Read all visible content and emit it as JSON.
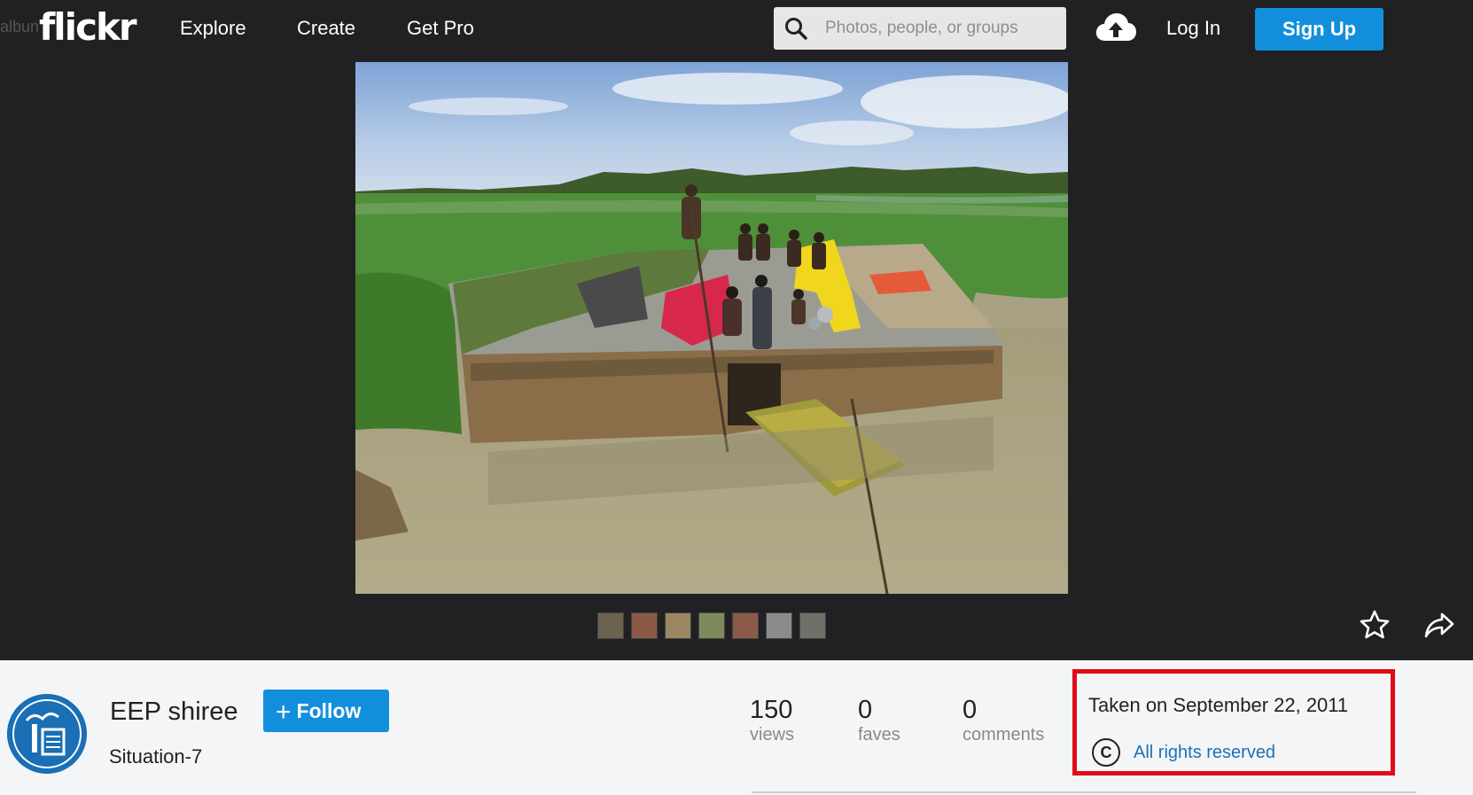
{
  "nav": {
    "ghost_text": "albun",
    "logo": "flickr",
    "links": [
      "Explore",
      "Create",
      "Get Pro"
    ],
    "search_placeholder": "Photos, people, or groups",
    "login": "Log In",
    "signup": "Sign Up"
  },
  "photo": {
    "thumbnails": [
      "thumb-1",
      "thumb-2",
      "thumb-3",
      "thumb-4",
      "thumb-5",
      "thumb-6",
      "thumb-7"
    ]
  },
  "owner": {
    "name": "EEP shiree",
    "follow_label": "Follow",
    "photo_title": "Situation-7"
  },
  "stats": {
    "views_count": "150",
    "views_label": "views",
    "faves_count": "0",
    "faves_label": "faves",
    "comments_count": "0",
    "comments_label": "comments"
  },
  "meta": {
    "taken": "Taken on September 22, 2011",
    "license_icon": "C",
    "license": "All rights reserved"
  },
  "colors": {
    "brand_blue": "#128fdc",
    "highlight_red": "#e10a1a",
    "link_blue": "#1e6fb5"
  }
}
